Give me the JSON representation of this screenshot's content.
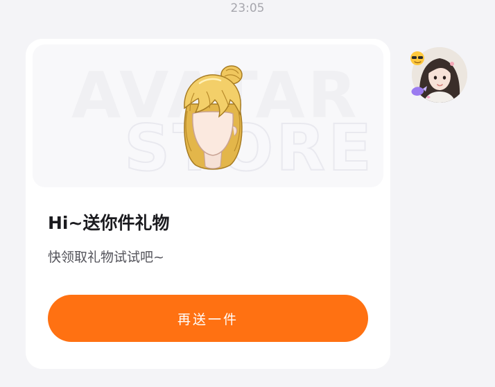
{
  "chat": {
    "timestamp": "23:05"
  },
  "gift_card": {
    "banner": {
      "watermark_line1": "AVATAR",
      "watermark_line2": "STORE",
      "image": "blonde-ponytail-hair-icon"
    },
    "title": "Hi~送你件礼物",
    "subtitle": "快领取礼物试试吧~",
    "action_label": "再送一件"
  },
  "sender": {
    "avatar": "user-avatar-icon"
  },
  "colors": {
    "background": "#f4f4f7",
    "card": "#ffffff",
    "banner": "#f8f8fa",
    "accent": "#ff7112",
    "title_text": "#1b1b1f",
    "subtitle_text": "#53535a",
    "timestamp_text": "#a6a6ad"
  }
}
